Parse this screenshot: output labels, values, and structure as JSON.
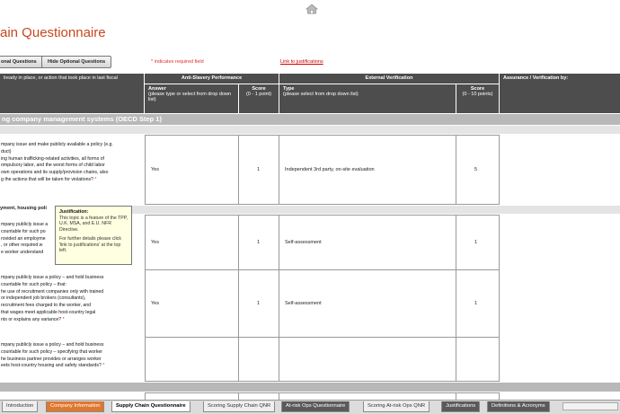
{
  "title": "ain Questionnaire",
  "buttons": {
    "show_optional": "onal Questions",
    "hide_optional": "Hide Optional Questions"
  },
  "required_note": "* indicates required field",
  "justifications_link": "Link to justifications",
  "header": {
    "col1": "lready in place, or action that took place in last fiscal",
    "anti_slavery": "Anti-Slavery Performance",
    "external": "External Verification",
    "assurance": "Assurance / Verification by:",
    "answer": "Answer",
    "answer_hint": "(please type or select from drop down list)",
    "score": "Score",
    "score_hint": "(0 - 1 point)",
    "type": "Type",
    "type_hint": "(please select from drop down list)",
    "score2": "Score",
    "score2_hint": "(0 - 10 points)"
  },
  "section": "ng company management systems (OECD Step 1)",
  "housing_label": "yment, housing poli",
  "rows": [
    {
      "question": "mpany issue and make publicly available a policy (e.g.\nduct)\ning human trafficking-related activities, all forms of\nompulsory labor, and the worst forms of child labor\nown operations and its supply/provision chains, also\ng the actions that will be taken for violations?",
      "answer": "Yes",
      "score": "1",
      "type": "Independent 3rd party, on-site evaluation",
      "score2": "5"
    },
    {
      "question": "mpany publicly issue a\ncountable for such po\nrovided an employme\n, or other required w\ne worker understand",
      "answer": "Yes",
      "score": "1",
      "type": "Self-assessment",
      "score2": "1"
    },
    {
      "question": "mpany publicly issue a policy – and hold business\ncountable for such policy – that:\nhe use of recruitment companies only with trained\nor independent job brokers (consultants),\nrecruitment fees charged to the worker, and\nthat wages meet applicable host-country legal\nnts or explains any variance?",
      "answer": "Yes",
      "score": "1",
      "type": "Self-assessment",
      "score2": "1"
    },
    {
      "question": "mpany publicly issue a policy – and hold business\ncountable for such policy – specifying that worker\nhe business partner provides or arranges worker\neets host-country housing and safety standards?",
      "answer": "",
      "score": "",
      "type": "",
      "score2": ""
    }
  ],
  "tooltip": {
    "title": "Justification:",
    "body": "This topic is a feature of the TPP, U.K. MSA, and E.U. NFR Directive.",
    "body2": "For further details please click 'link to justifications' at the top left."
  },
  "tabs": [
    "Introduction",
    "Company Information",
    "Supply Chain Questionnaire",
    "Scoring Supply Chain QNR",
    "At-risk Ops Questionnaire",
    "Scoring At-risk Ops QNR",
    "Justifications",
    "Definitions & Acronyms"
  ],
  "colors": {
    "title": "#c8461e",
    "required": "#e0312f",
    "header_bg": "#4d4d4d",
    "tab_orange": "#e0772f"
  },
  "icons": {
    "home": "house-icon"
  }
}
